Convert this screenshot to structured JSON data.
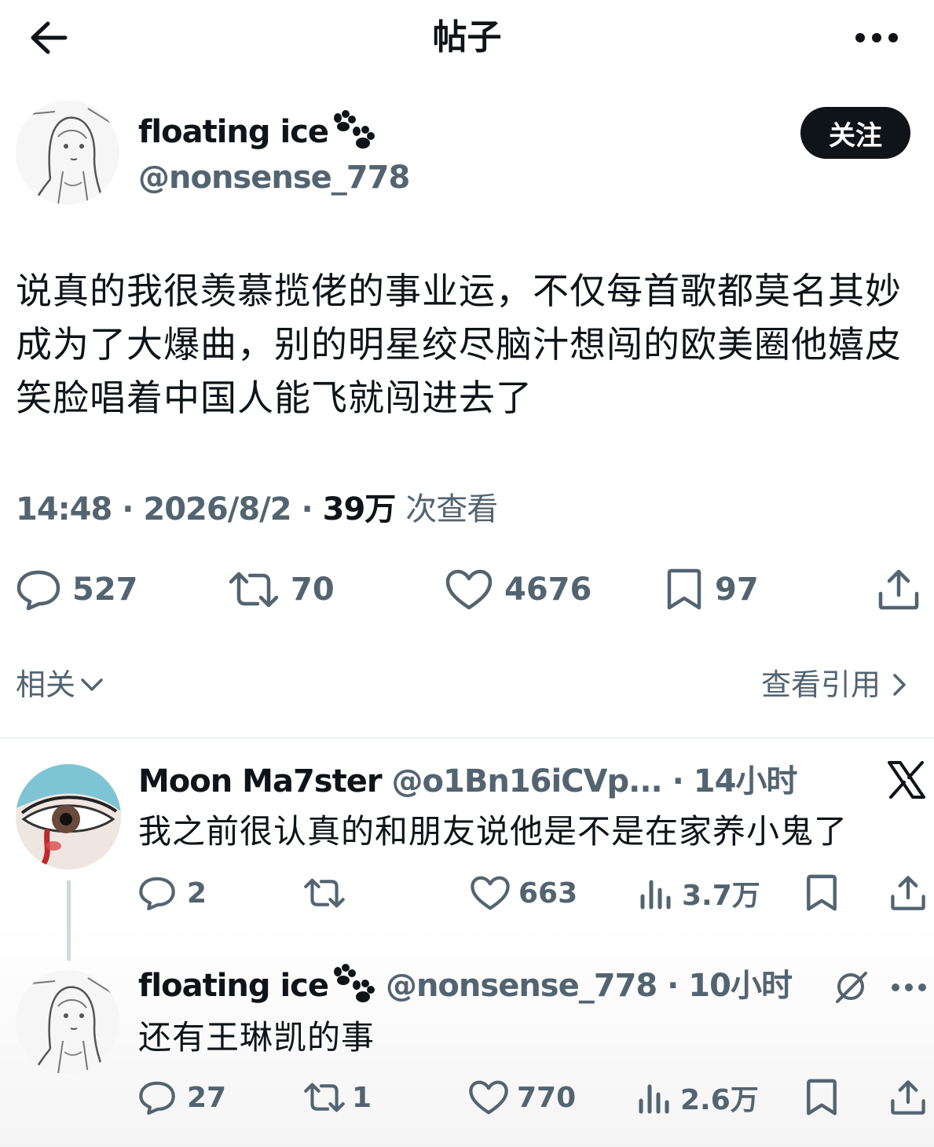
{
  "header": {
    "title": "帖子"
  },
  "post": {
    "author": {
      "name": "floating ice",
      "handle": "@nonsense_778"
    },
    "follow_label": "关注",
    "text": "说真的我很羡慕揽佬的事业运，不仅每首歌都莫名其妙成为了大爆曲，别的明星绞尽脑汁想闯的欧美圈他嬉皮笑脸唱着中国人能飞就闯进去了",
    "time": "14:48",
    "date": "2026/8/2",
    "views_count": "39万",
    "views_label": "次查看",
    "stats": {
      "replies": "527",
      "reposts": "70",
      "likes": "4676",
      "bookmarks": "97"
    }
  },
  "related": {
    "label": "相关"
  },
  "view_quotes": {
    "label": "查看引用"
  },
  "replies": [
    {
      "name": "Moon Ma7ster",
      "handle": "@o1Bn16iCVp...",
      "time": "14小时",
      "text": "我之前很认真的和朋友说他是不是在家养小鬼了",
      "stats": {
        "replies": "2",
        "reposts": "",
        "likes": "663",
        "views": "3.7万"
      }
    },
    {
      "name": "floating ice",
      "handle": "@nonsense_778",
      "time": "10小时",
      "text": "还有王琳凯的事",
      "stats": {
        "replies": "27",
        "reposts": "1",
        "likes": "770",
        "views": "2.6万"
      }
    }
  ],
  "icons": {
    "back": "arrow-left-icon",
    "more": "more-dots-icon",
    "reply": "speech-bubble-icon",
    "repost": "repost-arrows-icon",
    "like": "heart-icon",
    "bookmark": "bookmark-icon",
    "share": "share-upload-icon",
    "views": "bar-chart-icon",
    "x_logo": "x-logo-icon",
    "grok": "grok-slash-icon",
    "paw": "paw-print-icon"
  },
  "colors": {
    "text": "#0f1419",
    "secondary": "#536471",
    "follow_bg": "#0f1419"
  }
}
